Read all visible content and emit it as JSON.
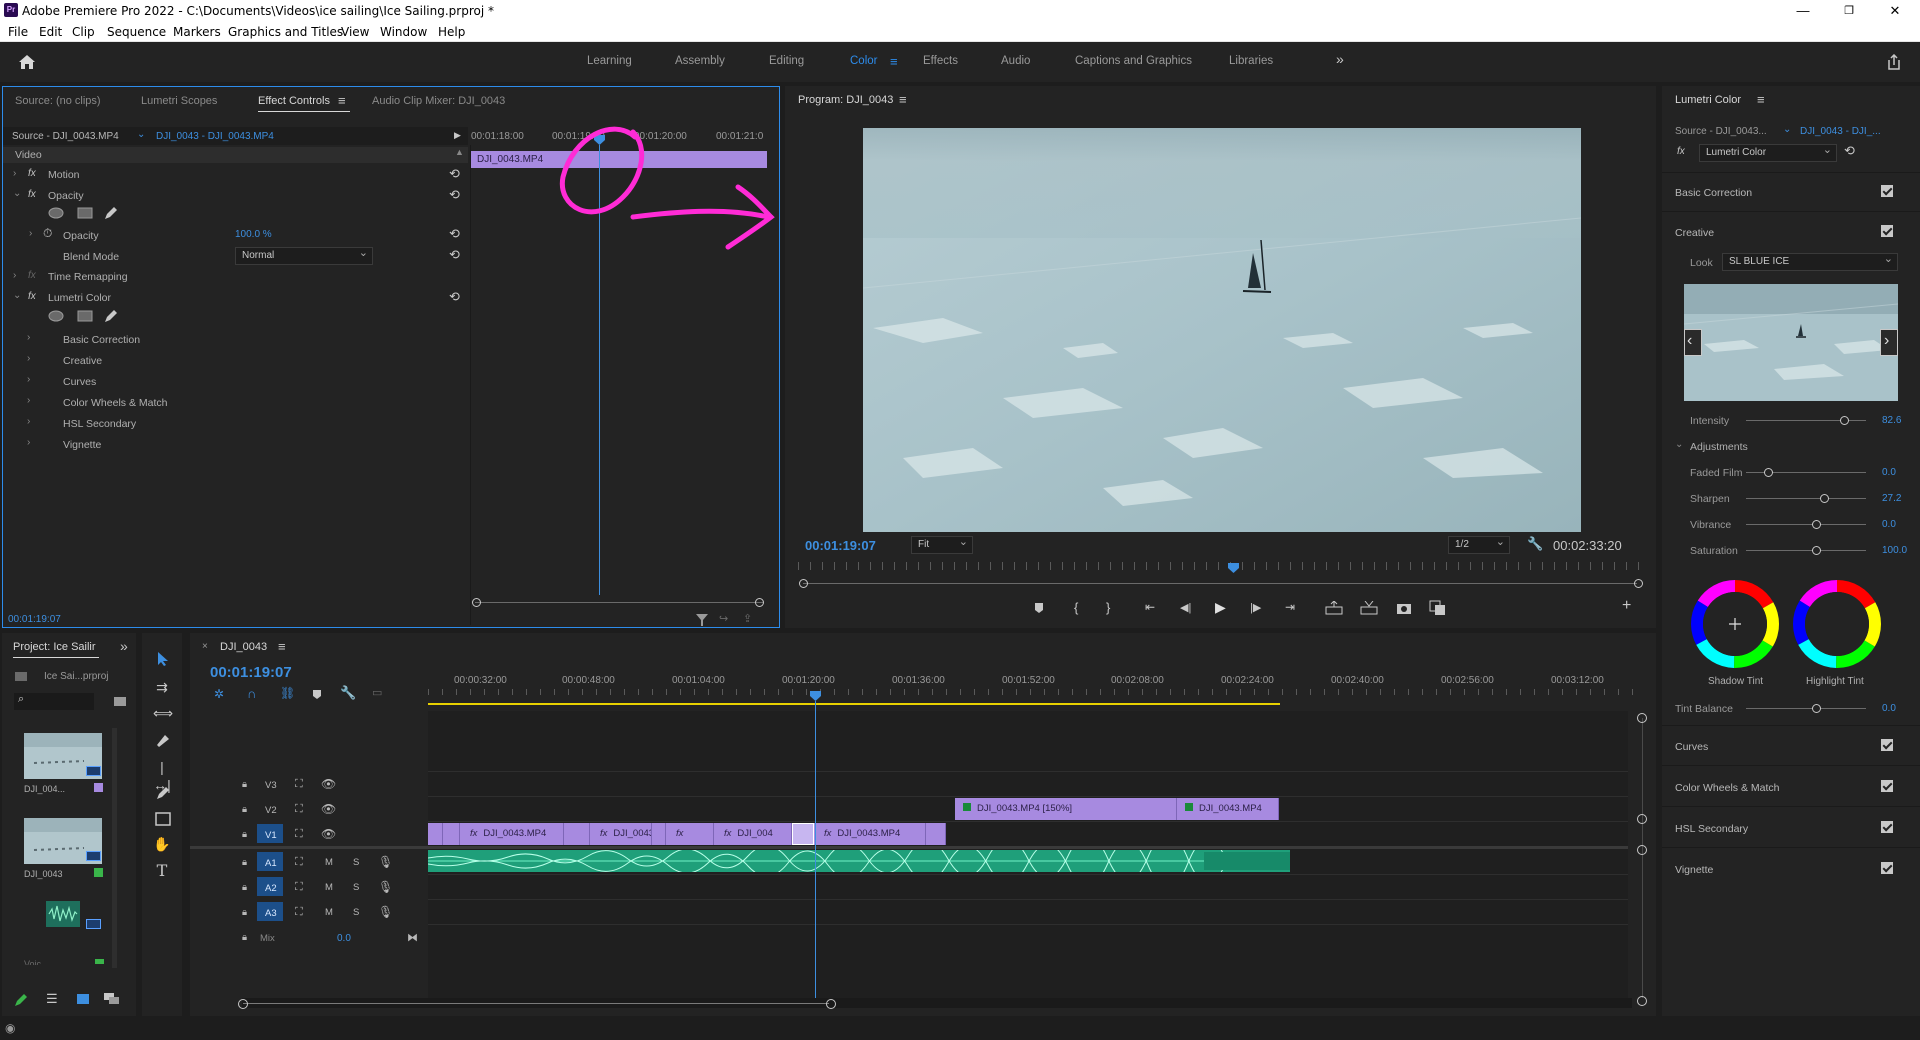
{
  "window": {
    "title": "Adobe Premiere Pro 2022 - C:\\Documents\\Videos\\ice sailing\\Ice Sailing.prproj *",
    "app_icon": "Pr",
    "controls": [
      "—",
      "❐",
      "✕"
    ]
  },
  "menu": [
    "File",
    "Edit",
    "Clip",
    "Sequence",
    "Markers",
    "Graphics and Titles",
    "View",
    "Window",
    "Help"
  ],
  "workspaces": {
    "items": [
      "Learning",
      "Assembly",
      "Editing",
      "Color",
      "Effects",
      "Audio",
      "Captions and Graphics",
      "Libraries"
    ],
    "active": "Color",
    "overflow": "»"
  },
  "source_panel": {
    "tabs": [
      "Source: (no clips)",
      "Lumetri Scopes",
      "Effect Controls",
      "Audio Clip Mixer: DJI_0043"
    ],
    "active_tab": "Effect Controls",
    "source_label": "Source - DJI_0043.MP4",
    "sequence_label": "DJI_0043 - DJI_0043.MP4",
    "ruler": [
      "00:01:18:00",
      "00:01:19:00",
      "00:01:20:00",
      "00:01:21:0"
    ],
    "clip_name": "DJI_0043.MP4",
    "section_video": "Video",
    "rows": [
      {
        "label": "Motion",
        "fx": true
      },
      {
        "label": "Opacity",
        "fx": true
      },
      {
        "label": "Opacity",
        "value": "100.0 %"
      },
      {
        "label": "Blend Mode",
        "value": "Normal"
      },
      {
        "label": "Time Remapping",
        "fx": true
      },
      {
        "label": "Lumetri Color",
        "fx": true
      },
      {
        "label": "Basic Correction"
      },
      {
        "label": "Creative"
      },
      {
        "label": "Curves"
      },
      {
        "label": "Color Wheels & Match"
      },
      {
        "label": "HSL Secondary"
      },
      {
        "label": "Vignette"
      }
    ],
    "timecode": "00:01:19:07"
  },
  "program_monitor": {
    "title": "Program: DJI_0043",
    "timecode": "00:01:19:07",
    "zoom": "Fit",
    "resolution": "1/2",
    "duration": "00:02:33:20"
  },
  "lumetri": {
    "title": "Lumetri Color",
    "source": "Source - DJI_0043...",
    "sequence": "DJI_0043 - DJI_...",
    "effect": "Lumetri Color",
    "sections": [
      "Basic Correction",
      "Creative"
    ],
    "look_label": "Look",
    "look_value": "SL BLUE ICE",
    "intensity_label": "Intensity",
    "intensity_value": "82.6",
    "adjustments": "Adjustments",
    "sliders": [
      {
        "label": "Faded Film",
        "value": "0.0",
        "level": 0
      },
      {
        "label": "Sharpen",
        "value": "27.2",
        "level": 0.64
      },
      {
        "label": "Vibrance",
        "value": "0.0",
        "level": 0.5
      },
      {
        "label": "Saturation",
        "value": "100.0",
        "level": 0.5
      }
    ],
    "wheels": [
      "Shadow Tint",
      "Highlight Tint"
    ],
    "tint_balance_label": "Tint Balance",
    "tint_balance_value": "0.0",
    "bottom_sections": [
      "Curves",
      "Color Wheels & Match",
      "HSL Secondary",
      "Vignette"
    ]
  },
  "project": {
    "tab": "Project: Ice Sailir",
    "file": "Ice Sai...prproj",
    "items": [
      {
        "name": "DJI_004..."
      },
      {
        "name": "DJI_0043"
      },
      {
        "name": "Voic..."
      }
    ]
  },
  "timeline": {
    "tab": "DJI_0043",
    "timecode": "00:01:19:07",
    "ruler": [
      "00:00:32:00",
      "00:00:48:00",
      "00:01:04:00",
      "00:01:20:00",
      "00:01:36:00",
      "00:01:52:00",
      "00:02:08:00",
      "00:02:24:00",
      "00:02:40:00",
      "00:02:56:00",
      "00:03:12:00"
    ],
    "tracks_video": [
      "V3",
      "V2",
      "V1"
    ],
    "tracks_audio": [
      "A1",
      "A2",
      "A3"
    ],
    "mix_label": "Mix",
    "mix_value": "0.0",
    "v2_clips": [
      "DJI_0043.MP4 [150%]",
      "DJI_0043.MP4"
    ],
    "v1_clips": [
      "",
      "",
      "DJI_0043.MP4",
      "",
      "DJI_0043.",
      "",
      "",
      "DJI_004",
      "",
      "DJI_0043.MP4",
      ""
    ]
  }
}
